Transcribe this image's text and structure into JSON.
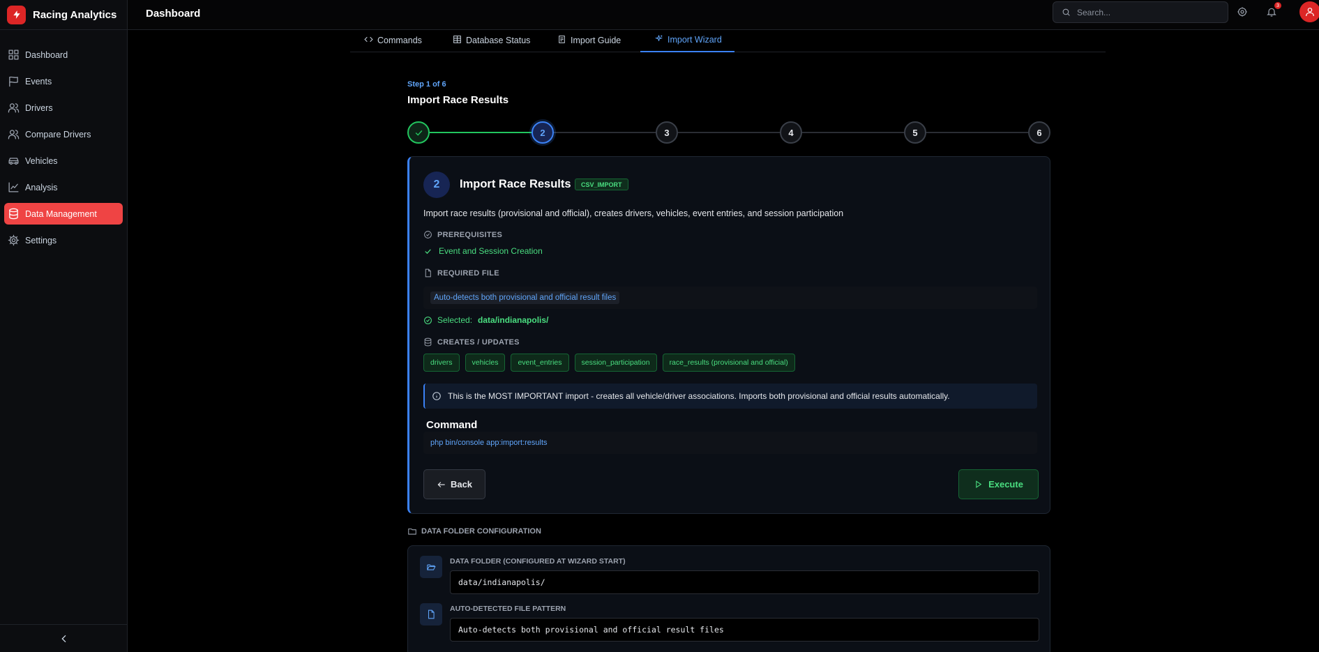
{
  "app": {
    "name": "Racing Analytics"
  },
  "sidebar": {
    "items": [
      {
        "label": "Dashboard",
        "icon": "grid-icon"
      },
      {
        "label": "Events",
        "icon": "flag-icon"
      },
      {
        "label": "Drivers",
        "icon": "users-icon"
      },
      {
        "label": "Compare Drivers",
        "icon": "users-compare-icon"
      },
      {
        "label": "Vehicles",
        "icon": "car-icon"
      },
      {
        "label": "Analysis",
        "icon": "chart-line-icon"
      },
      {
        "label": "Data Management",
        "icon": "database-icon",
        "active": true
      },
      {
        "label": "Settings",
        "icon": "gear-icon"
      }
    ]
  },
  "header": {
    "title": "Dashboard",
    "search_placeholder": "Search...",
    "notification_count": "3"
  },
  "tabs": [
    {
      "label": "Commands",
      "icon": "code-icon"
    },
    {
      "label": "Database Status",
      "icon": "table-icon"
    },
    {
      "label": "Import Guide",
      "icon": "book-icon"
    },
    {
      "label": "Import Wizard",
      "icon": "sparkles-icon",
      "active": true
    }
  ],
  "wizard": {
    "step_of": "Step 1 of 6",
    "title": "Import Race Results",
    "steps": [
      "1",
      "2",
      "3",
      "4",
      "5",
      "6"
    ],
    "completed_steps": 1,
    "current_step": 2
  },
  "step_card": {
    "number": "2",
    "title": "Import Race Results",
    "tag": "CSV_IMPORT",
    "description": "Import race results (provisional and official), creates drivers, vehicles, event entries, and session participation",
    "prereq_label": "PREREQUISITES",
    "prereq_item": "Event and Session Creation",
    "required_file_label": "REQUIRED FILE",
    "required_file": "Auto-detects both provisional and official result files",
    "selected_label": "Selected:",
    "selected_value": "data/indianapolis/",
    "creates_label": "CREATES / UPDATES",
    "creates": [
      "drivers",
      "vehicles",
      "event_entries",
      "session_participation",
      "race_results (provisional and official)"
    ],
    "info": "This is the MOST IMPORTANT import - creates all vehicle/driver associations. Imports both provisional and official results automatically.",
    "command_label": "Command",
    "command": "php bin/console app:import:results",
    "back_label": "Back",
    "execute_label": "Execute"
  },
  "config": {
    "section_label": "DATA FOLDER CONFIGURATION",
    "folder_label": "DATA FOLDER (CONFIGURED AT WIZARD START)",
    "folder_value": "data/indianapolis/",
    "pattern_label": "AUTO-DETECTED FILE PATTERN",
    "pattern_value": "Auto-detects both provisional and official result files"
  },
  "colors": {
    "accent_red": "#ef4444",
    "accent_blue": "#3b82f6",
    "accent_green": "#22c55e"
  }
}
